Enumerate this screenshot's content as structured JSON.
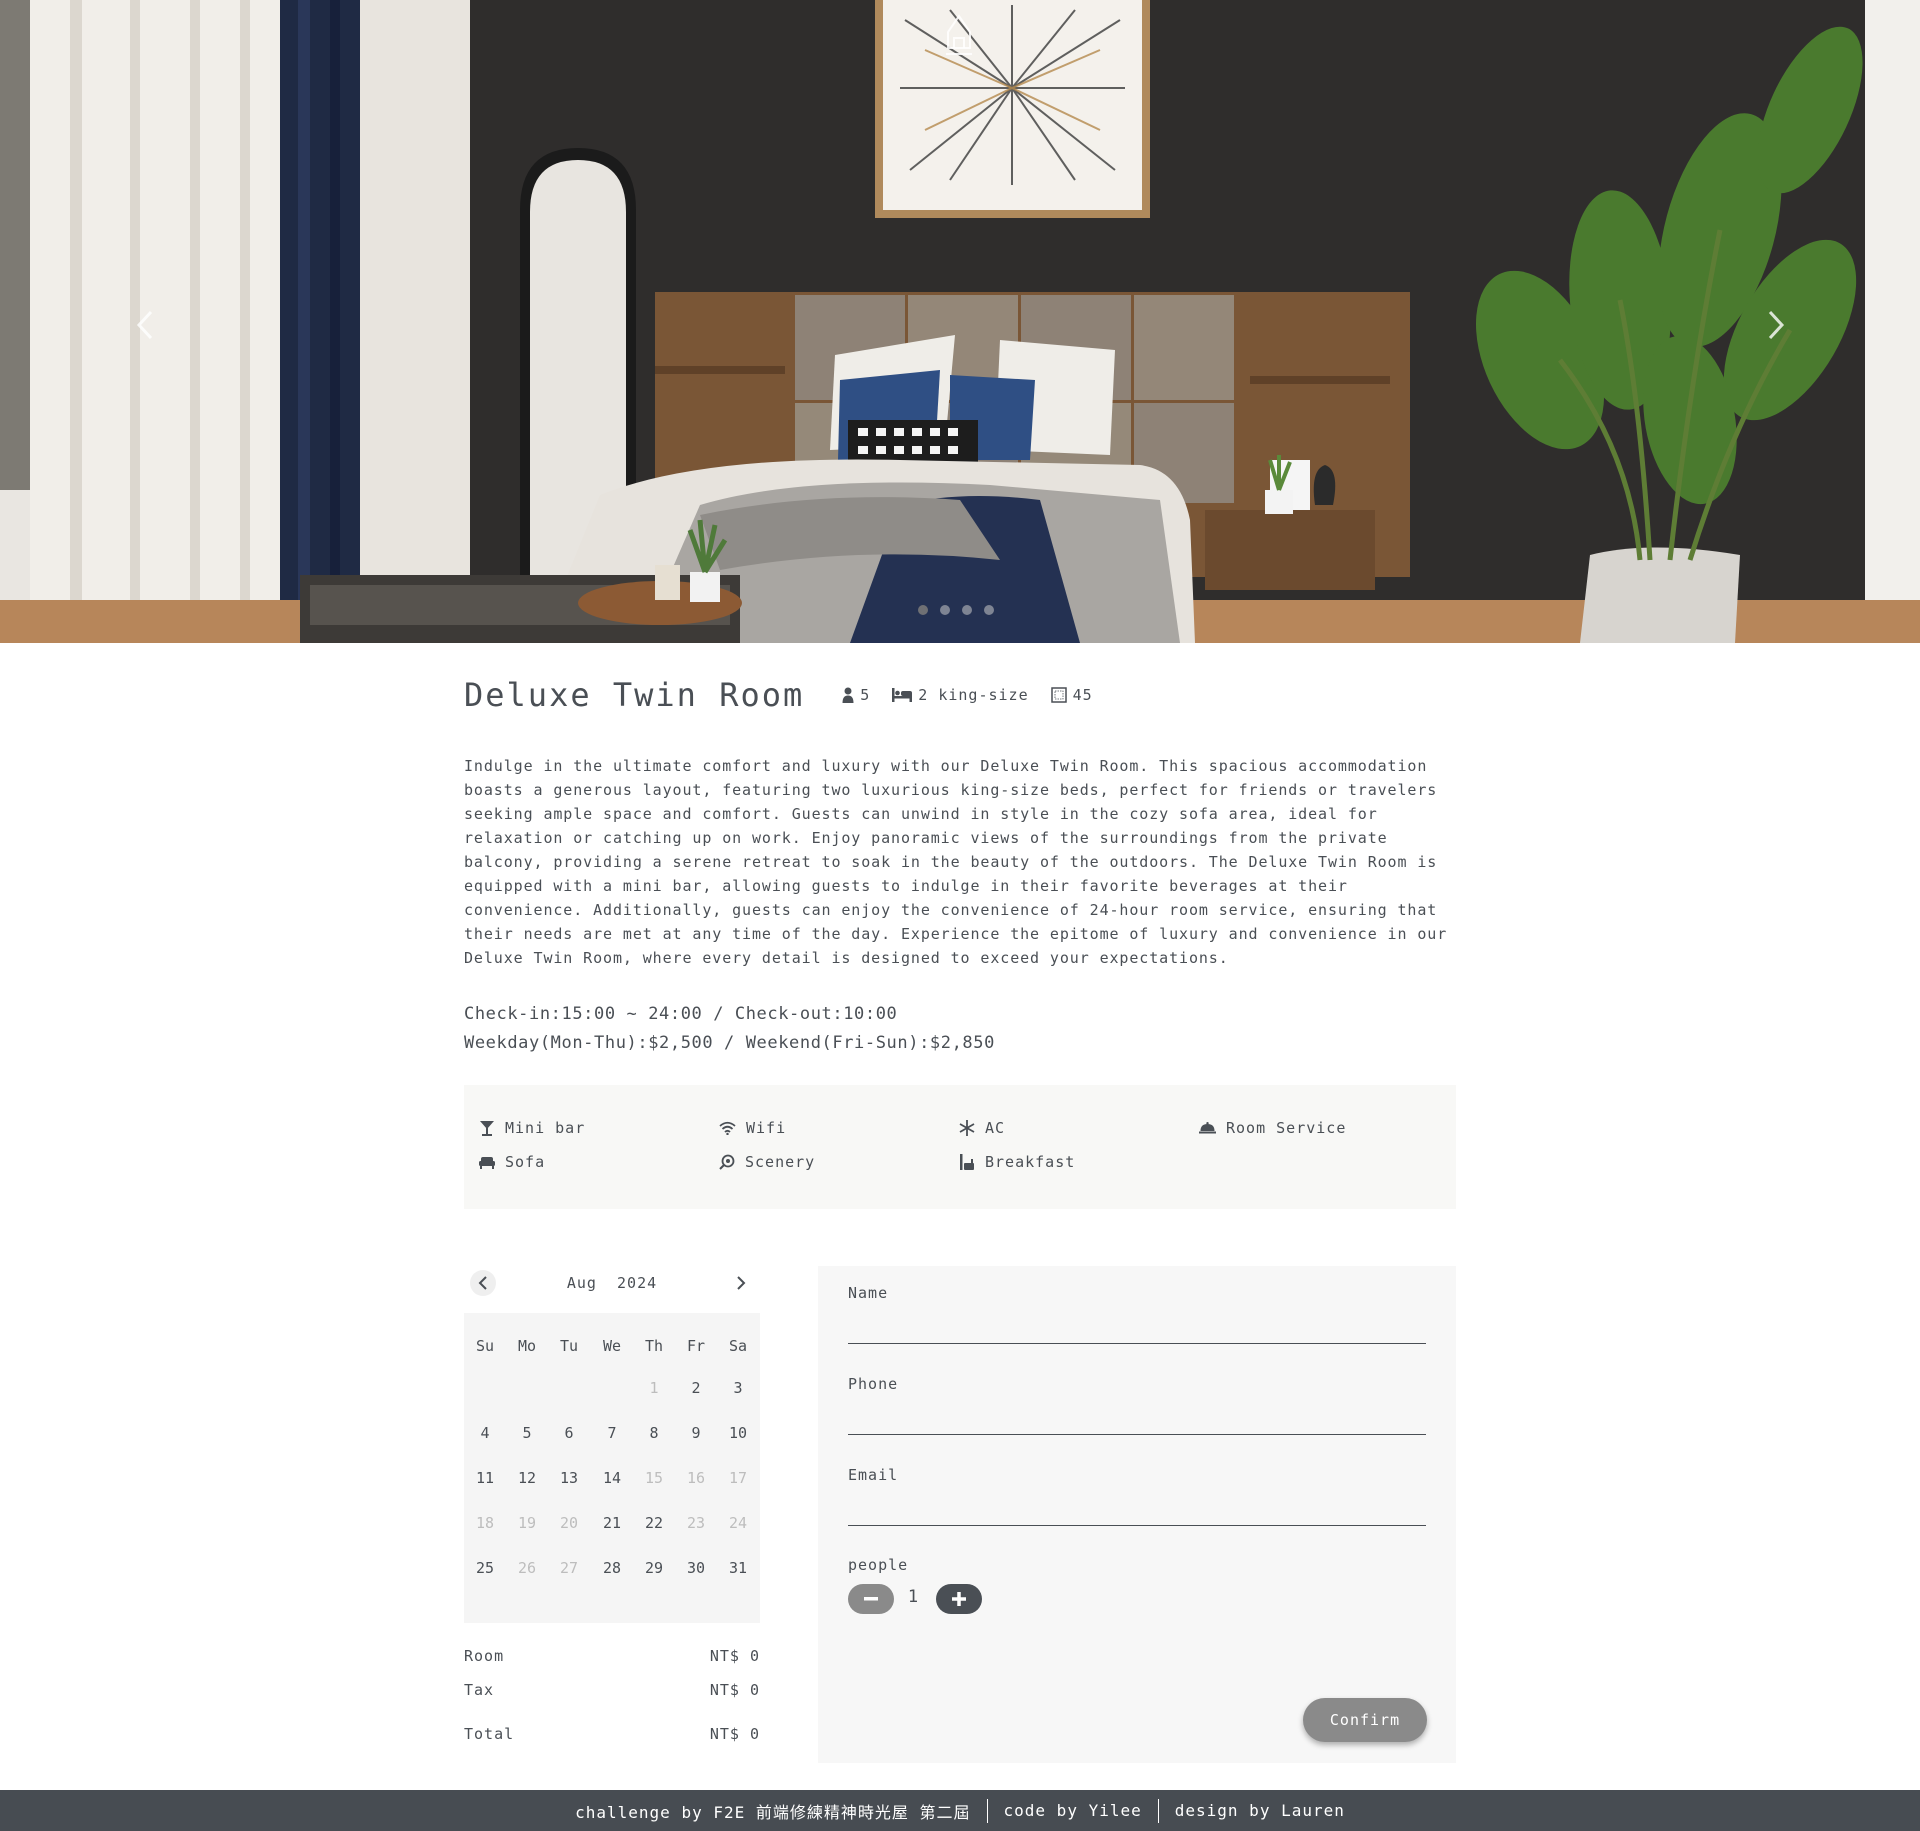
{
  "hero": {
    "slides_count": 4,
    "active_slide": 1
  },
  "room": {
    "title": "Deluxe Twin Room",
    "capacity": "5",
    "beds": "2 king-size",
    "size": "45",
    "description": "Indulge in the ultimate comfort and luxury with our Deluxe Twin Room. This spacious accommodation boasts a generous layout, featuring two luxurious king-size beds, perfect for friends or travelers seeking ample space and comfort. Guests can unwind in style in the cozy sofa area, ideal for relaxation or catching up on work. Enjoy panoramic views of the surroundings from the private balcony, providing a serene retreat to soak in the beauty of the outdoors. The Deluxe Twin Room is equipped with a mini bar, allowing guests to indulge in their favorite beverages at their convenience. Additionally, guests can enjoy the convenience of 24-hour room service, ensuring that their needs are met at any time of the day. Experience the epitome of luxury and convenience in our Deluxe Twin Room, where every detail is designed to exceed your expectations.",
    "checkin_line": "Check-in:15:00 ~ 24:00 / Check-out:10:00",
    "price_line": "Weekday(Mon-Thu):$2,500 / Weekend(Fri-Sun):$2,850"
  },
  "amenities": [
    {
      "label": "Mini bar",
      "icon": "cocktail-icon"
    },
    {
      "label": "Wifi",
      "icon": "wifi-icon"
    },
    {
      "label": "AC",
      "icon": "snowflake-icon"
    },
    {
      "label": "Room Service",
      "icon": "cloche-icon"
    },
    {
      "label": "Sofa",
      "icon": "sofa-icon"
    },
    {
      "label": "Scenery",
      "icon": "scenery-icon"
    },
    {
      "label": "Breakfast",
      "icon": "breakfast-icon"
    }
  ],
  "calendar": {
    "month_label": "Aug  2024",
    "weekdays": [
      "Su",
      "Mo",
      "Tu",
      "We",
      "Th",
      "Fr",
      "Sa"
    ],
    "first_weekday_index": 4,
    "days": [
      {
        "d": "1",
        "disabled": true
      },
      {
        "d": "2",
        "disabled": false
      },
      {
        "d": "3",
        "disabled": false
      },
      {
        "d": "4",
        "disabled": false
      },
      {
        "d": "5",
        "disabled": false
      },
      {
        "d": "6",
        "disabled": false
      },
      {
        "d": "7",
        "disabled": false
      },
      {
        "d": "8",
        "disabled": false
      },
      {
        "d": "9",
        "disabled": false
      },
      {
        "d": "10",
        "disabled": false
      },
      {
        "d": "11",
        "disabled": false
      },
      {
        "d": "12",
        "disabled": false
      },
      {
        "d": "13",
        "disabled": false
      },
      {
        "d": "14",
        "disabled": false
      },
      {
        "d": "15",
        "disabled": true
      },
      {
        "d": "16",
        "disabled": true
      },
      {
        "d": "17",
        "disabled": true
      },
      {
        "d": "18",
        "disabled": true
      },
      {
        "d": "19",
        "disabled": true
      },
      {
        "d": "20",
        "disabled": true
      },
      {
        "d": "21",
        "disabled": false
      },
      {
        "d": "22",
        "disabled": false
      },
      {
        "d": "23",
        "disabled": true
      },
      {
        "d": "24",
        "disabled": true
      },
      {
        "d": "25",
        "disabled": false
      },
      {
        "d": "26",
        "disabled": true
      },
      {
        "d": "27",
        "disabled": true
      },
      {
        "d": "28",
        "disabled": false
      },
      {
        "d": "29",
        "disabled": false
      },
      {
        "d": "30",
        "disabled": false
      },
      {
        "d": "31",
        "disabled": false
      }
    ]
  },
  "summary": {
    "room_label": "Room",
    "room_value": "NT$ 0",
    "tax_label": "Tax",
    "tax_value": "NT$ 0",
    "total_label": "Total",
    "total_value": "NT$ 0"
  },
  "form": {
    "name_label": "Name",
    "name_value": "",
    "phone_label": "Phone",
    "phone_value": "",
    "email_label": "Email",
    "email_value": "",
    "people_label": "people",
    "people_value": "1",
    "confirm_label": "Confirm"
  },
  "footer": {
    "challenge": "challenge by F2E 前端修練精神時光屋 第二屆",
    "code": "code by Yilee",
    "design": "design by Lauren"
  },
  "colors": {
    "text": "#4a4f55",
    "footer_bg": "#474c52",
    "panel_bg": "#f7f7f7",
    "button_gray": "#8a8a8a"
  }
}
